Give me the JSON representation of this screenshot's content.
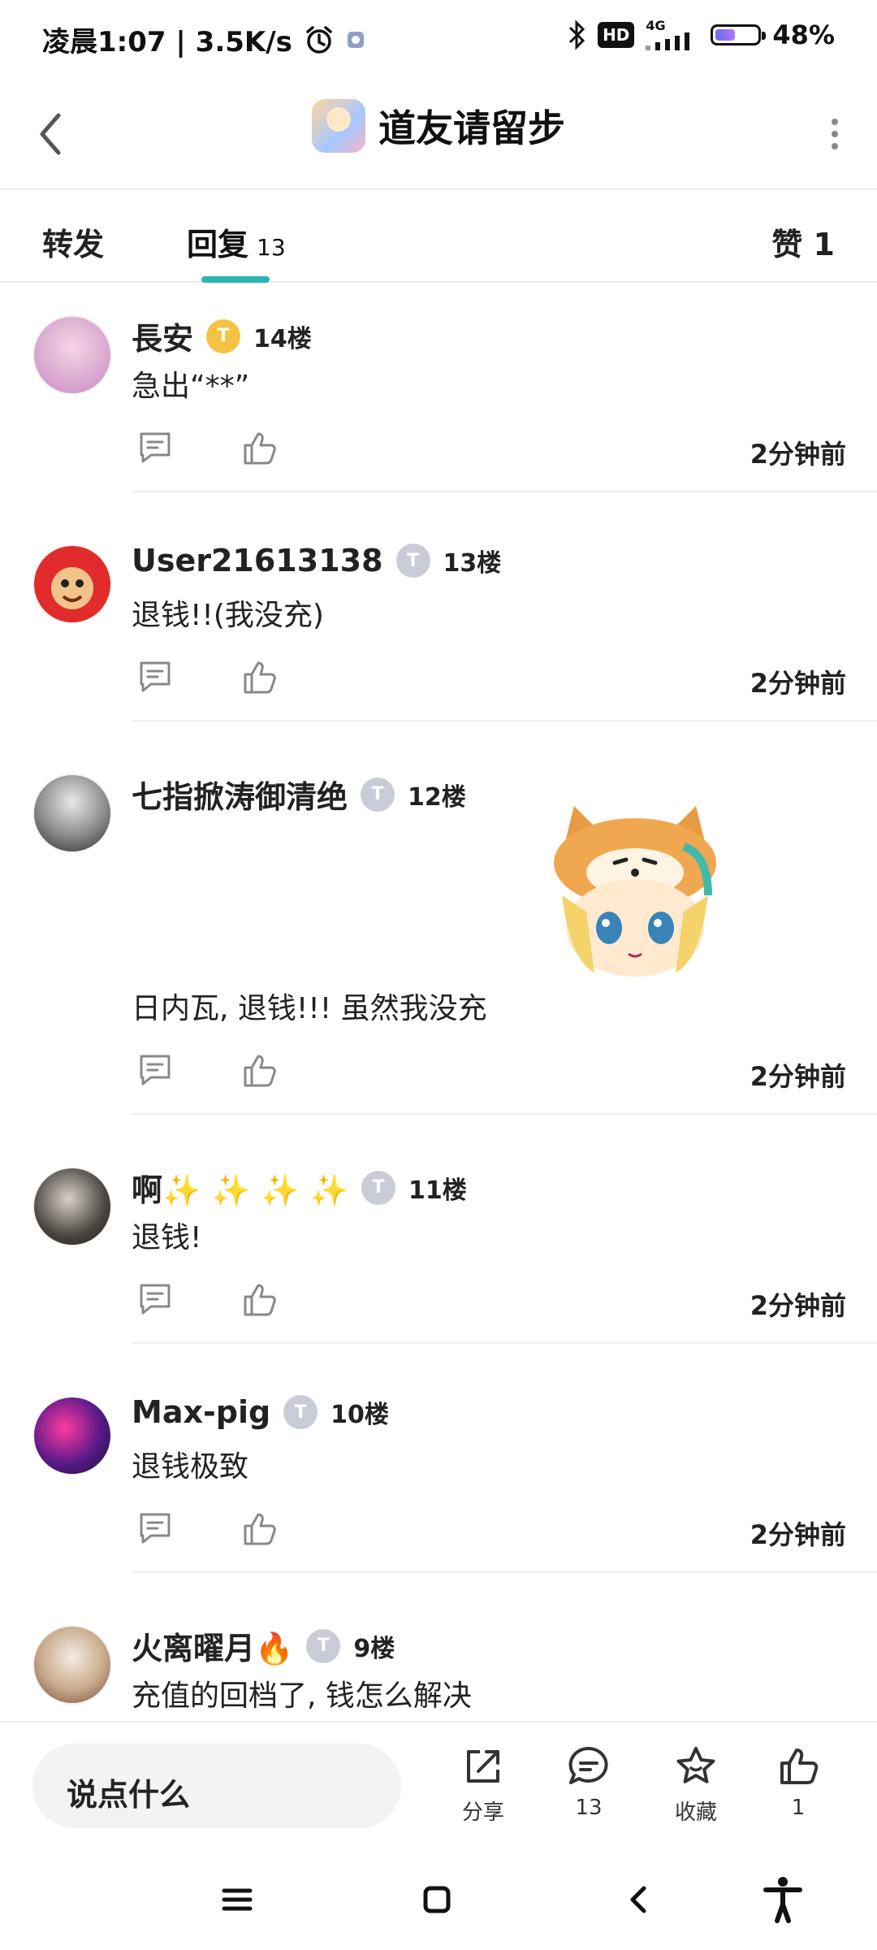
{
  "status_bar": {
    "left_text": "凌晨1:07 | 3.5K/s",
    "hd": "HD",
    "network": "4G",
    "battery": "48%",
    "battery_level": 0.48
  },
  "header": {
    "title": "道友请留步"
  },
  "tabs": {
    "forward": "转发",
    "reply": "回复",
    "reply_count": "13",
    "like": "赞 1"
  },
  "comments": [
    {
      "username": "長安",
      "badge": "T",
      "floor": "14楼",
      "text": "急出“**”",
      "time": "2分钟前"
    },
    {
      "username": "User21613138",
      "badge": "T",
      "floor": "13楼",
      "text": "退钱!!(我没充)",
      "time": "2分钟前"
    },
    {
      "username": "七指掀涛御清绝",
      "badge": "T",
      "floor": "12楼",
      "text": "日内瓦, 退钱!!! 虽然我没充",
      "time": "2分钟前"
    },
    {
      "username": "啊✨ ✨ ✨ ✨",
      "badge": "T",
      "floor": "11楼",
      "text": "退钱!",
      "time": "2分钟前"
    },
    {
      "username": "Max-pig",
      "badge": "T",
      "floor": "10楼",
      "text": "退钱极致",
      "time": "2分钟前"
    },
    {
      "username": "火离曜月🔥",
      "badge": "T",
      "floor": "9楼",
      "text": "充值的回档了, 钱怎么解决",
      "time": ""
    }
  ],
  "bottom_bar": {
    "input_placeholder": "说点什么",
    "share_label": "分享",
    "comment_count": "13",
    "favorite_label": "收藏",
    "like_count": "1"
  },
  "colors": {
    "accent": "#2ab4b8",
    "gold_badge": "#f7c244",
    "silver_badge": "#c9ccd6"
  }
}
